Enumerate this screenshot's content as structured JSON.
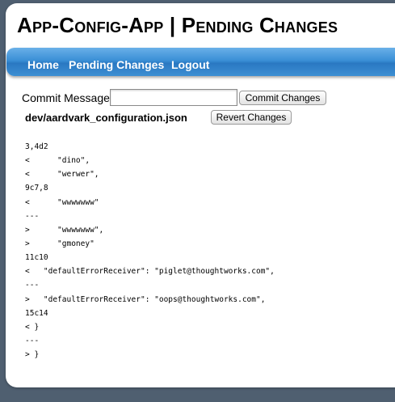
{
  "header": {
    "title": "App-Config-App | Pending Changes"
  },
  "nav": {
    "items": [
      {
        "label": "Home"
      },
      {
        "label": "Pending Changes"
      },
      {
        "label": "Logout"
      }
    ]
  },
  "commit": {
    "label": "Commit Message:",
    "input_value": "",
    "button_label": "Commit Changes"
  },
  "file": {
    "name": "dev/aardvark_configuration.json",
    "revert_label": "Revert Changes"
  },
  "diff_lines": [
    "3,4d2",
    "<      \"dino\",",
    "<      \"werwer\",",
    "9c7,8",
    "<      \"wwwwwww\"",
    "---",
    ">      \"wwwwwww\",",
    ">      \"gmoney\"",
    "11c10",
    "<   \"defaultErrorReceiver\": \"piglet@thoughtworks.com\",",
    "---",
    ">   \"defaultErrorReceiver\": \"oops@thoughtworks.com\",",
    "15c14",
    "< }",
    "---",
    "> }"
  ],
  "colors": {
    "background": "#4f5f70",
    "nav_blue": "#3a8fd6",
    "nav_text": "#ffffff"
  }
}
